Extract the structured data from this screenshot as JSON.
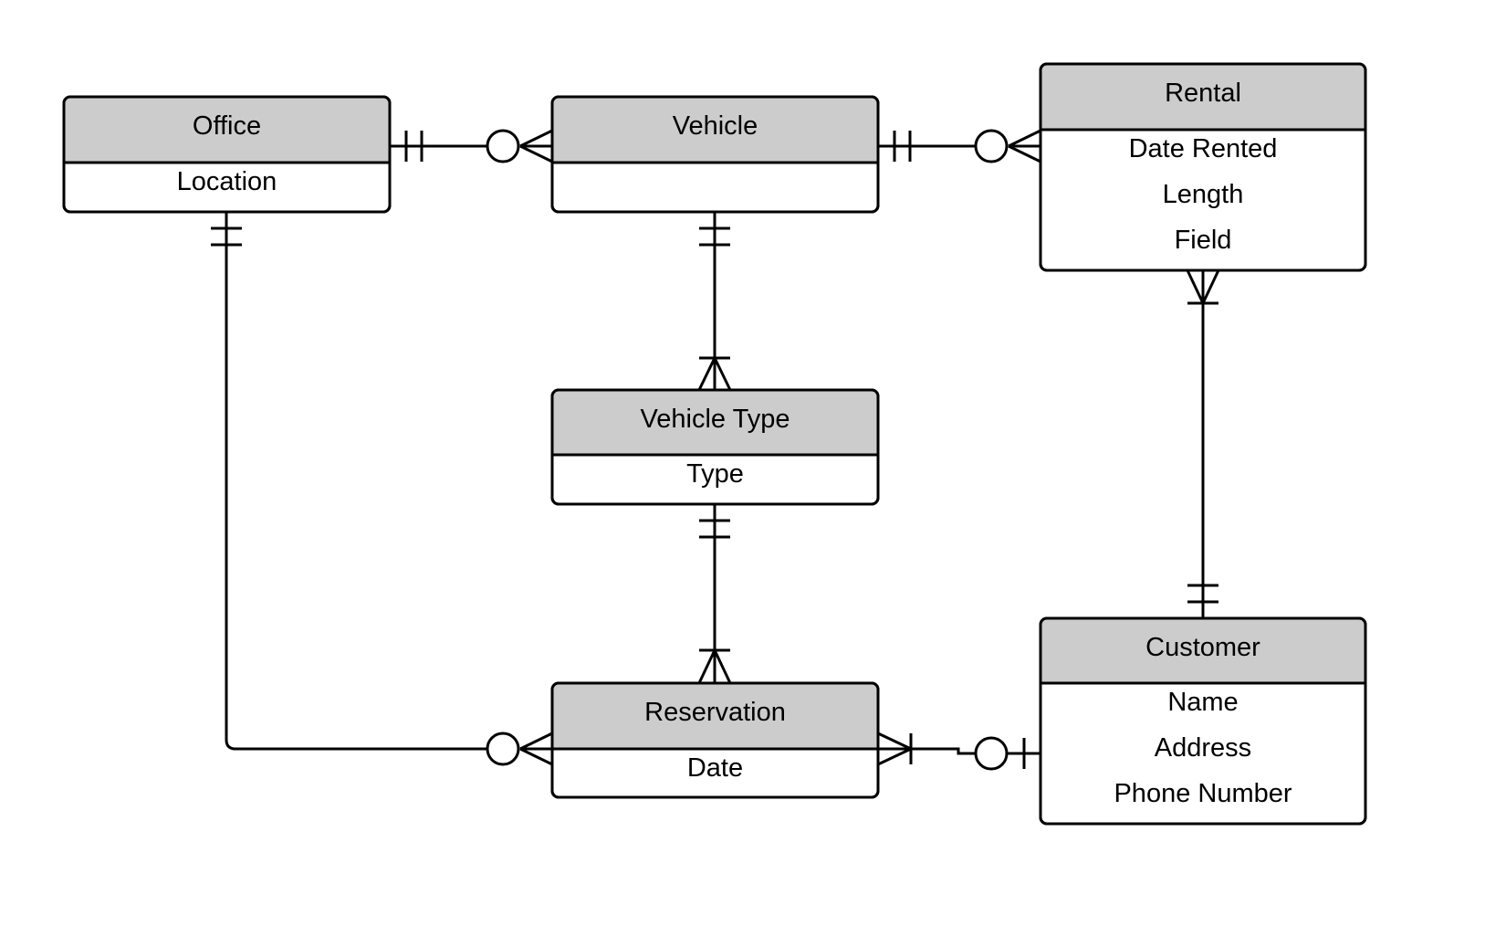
{
  "entities": [
    {
      "name": "Office",
      "attributes": [
        "Location"
      ]
    },
    {
      "name": "Vehicle",
      "attributes": []
    },
    {
      "name": "Rental",
      "attributes": [
        "Date Rented",
        "Length",
        "Field"
      ]
    },
    {
      "name": "Vehicle Type",
      "attributes": [
        "Type"
      ]
    },
    {
      "name": "Reservation",
      "attributes": [
        "Date"
      ]
    },
    {
      "name": "Customer",
      "attributes": [
        "Name",
        "Address",
        "Phone Number"
      ]
    }
  ],
  "relationships": [
    {
      "from": "Office",
      "to": "Vehicle",
      "from_cardinality": "one-and-only-one",
      "to_cardinality": "zero-or-many"
    },
    {
      "from": "Vehicle",
      "to": "Rental",
      "from_cardinality": "one-and-only-one",
      "to_cardinality": "zero-or-many"
    },
    {
      "from": "Office",
      "to": "Reservation",
      "from_cardinality": "one-and-only-one",
      "to_cardinality": "zero-or-many"
    },
    {
      "from": "Vehicle",
      "to": "Vehicle Type",
      "from_cardinality": "one-and-only-one",
      "to_cardinality": "one-or-many"
    },
    {
      "from": "Vehicle Type",
      "to": "Reservation",
      "from_cardinality": "one-and-only-one",
      "to_cardinality": "one-or-many"
    },
    {
      "from": "Rental",
      "to": "Customer",
      "from_cardinality": "one-or-many",
      "to_cardinality": "one-and-only-one"
    },
    {
      "from": "Reservation",
      "to": "Customer",
      "from_cardinality": "one-or-many",
      "to_cardinality": "zero-or-one"
    }
  ],
  "colors": {
    "header_fill": "#cccccc",
    "body_fill": "#ffffff",
    "stroke": "#000000"
  }
}
